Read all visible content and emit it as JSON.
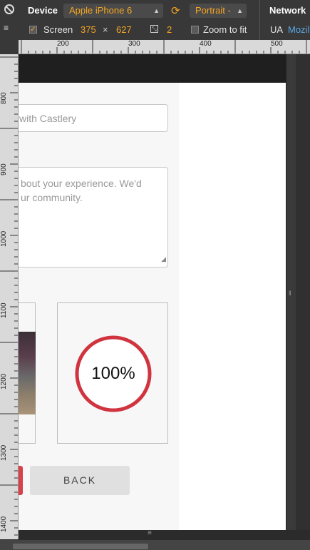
{
  "toolbar": {
    "device_label": "Device",
    "device_value": "Apple iPhone 6",
    "orientation_value": "Portrait -",
    "screen_label": "Screen",
    "screen_width": "375",
    "times": "×",
    "screen_height": "627",
    "pixel_ratio": "2",
    "zoom_label": "Zoom to fit",
    "network_label": "Network",
    "ua_label": "UA",
    "ua_value": "Mozil"
  },
  "ruler": {
    "h_ticks": [
      "200",
      "300",
      "400",
      "500"
    ],
    "v_ticks": [
      "800",
      "900",
      "1000",
      "1100",
      "1200",
      "1300",
      "1400"
    ]
  },
  "form": {
    "name_value": "with Castlery",
    "review_text_line1": "bout your experience. We'd",
    "review_text_line2": "ur community.",
    "progress_text": "100%",
    "progress_percent": 100,
    "back_button": "BACK"
  },
  "colors": {
    "accent": "#f5a623",
    "progress_ring": "#d0343f",
    "red_button": "#d8404a"
  }
}
